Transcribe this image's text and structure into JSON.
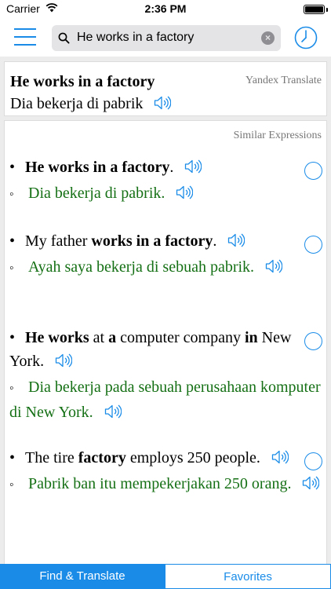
{
  "status_bar": {
    "carrier": "Carrier",
    "time": "2:36 PM"
  },
  "search": {
    "value": "He works in a factory",
    "clear_glyph": "×"
  },
  "translation": {
    "source": "He works in a factory",
    "target": "Dia bekerja di pabrik",
    "engine": "Yandex Translate"
  },
  "similar": {
    "header": "Similar Expressions",
    "entries": [
      {
        "source_parts": [
          {
            "t": "He works in a factory",
            "b": true
          },
          {
            "t": ".",
            "b": false
          }
        ],
        "target": "Dia bekerja di pabrik."
      },
      {
        "source_parts": [
          {
            "t": "My father ",
            "b": false
          },
          {
            "t": "works in a factory",
            "b": true
          },
          {
            "t": ".",
            "b": false
          }
        ],
        "target": "Ayah saya bekerja di sebuah pabrik."
      },
      {
        "source_parts": [
          {
            "t": "He works",
            "b": true
          },
          {
            "t": " at ",
            "b": false
          },
          {
            "t": "a",
            "b": true
          },
          {
            "t": " computer company ",
            "b": false
          },
          {
            "t": "in",
            "b": true
          },
          {
            "t": " New York.",
            "b": false
          }
        ],
        "target": "Dia bekerja pada sebuah perusahaan komputer di New York."
      },
      {
        "source_parts": [
          {
            "t": "The tire ",
            "b": false
          },
          {
            "t": "factory",
            "b": true
          },
          {
            "t": " employs 250 people.",
            "b": false
          }
        ],
        "target": "Pabrik ban itu mempekerjakan 250 orang."
      }
    ]
  },
  "tabs": {
    "find_translate": "Find & Translate",
    "favorites": "Favorites"
  },
  "colors": {
    "accent": "#1a8ce8",
    "translation_green": "#157015"
  },
  "icons": {
    "menu": "menu-icon",
    "search": "search-icon",
    "clear": "clear-icon",
    "history": "clock-icon",
    "speaker": "speaker-icon"
  }
}
